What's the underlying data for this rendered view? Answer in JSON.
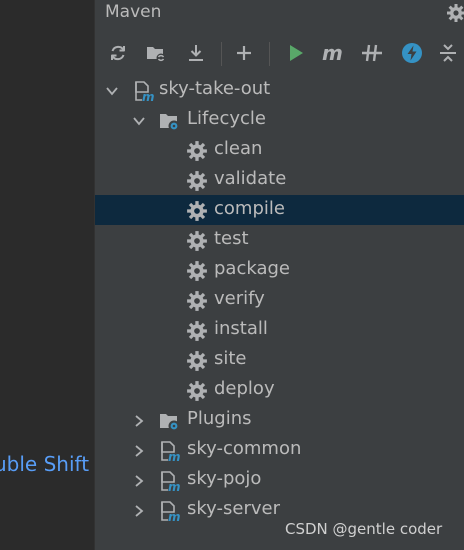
{
  "left_pane": {
    "hint_text": "uble Shift"
  },
  "panel": {
    "title": "Maven"
  },
  "toolbar": {
    "buttons": [
      {
        "name": "reload-icon"
      },
      {
        "name": "generate-sources-icon"
      },
      {
        "name": "download-icon"
      },
      {
        "name": "add-icon"
      },
      {
        "name": "run-icon"
      },
      {
        "name": "execute-goal-icon"
      },
      {
        "name": "toggle-offline-icon"
      },
      {
        "name": "skip-tests-icon"
      },
      {
        "name": "collapse-all-icon"
      }
    ]
  },
  "tree": {
    "root": {
      "label": "sky-take-out",
      "expanded": true
    },
    "lifecycle": {
      "label": "Lifecycle",
      "expanded": true
    },
    "goals": [
      {
        "label": "clean"
      },
      {
        "label": "validate"
      },
      {
        "label": "compile",
        "selected": true
      },
      {
        "label": "test"
      },
      {
        "label": "package"
      },
      {
        "label": "verify"
      },
      {
        "label": "install"
      },
      {
        "label": "site"
      },
      {
        "label": "deploy"
      }
    ],
    "plugins": {
      "label": "Plugins",
      "expanded": false
    },
    "modules": [
      {
        "label": "sky-common"
      },
      {
        "label": "sky-pojo"
      },
      {
        "label": "sky-server"
      }
    ]
  },
  "watermark": "CSDN @gentle coder",
  "colors": {
    "panel_bg": "#3c3f41",
    "editor_bg": "#2b2b2b",
    "selection_bg": "#0d293e",
    "text": "#bbbbbb",
    "link_blue": "#589df6",
    "run_green": "#59a869",
    "maven_blue": "#3592c4"
  }
}
